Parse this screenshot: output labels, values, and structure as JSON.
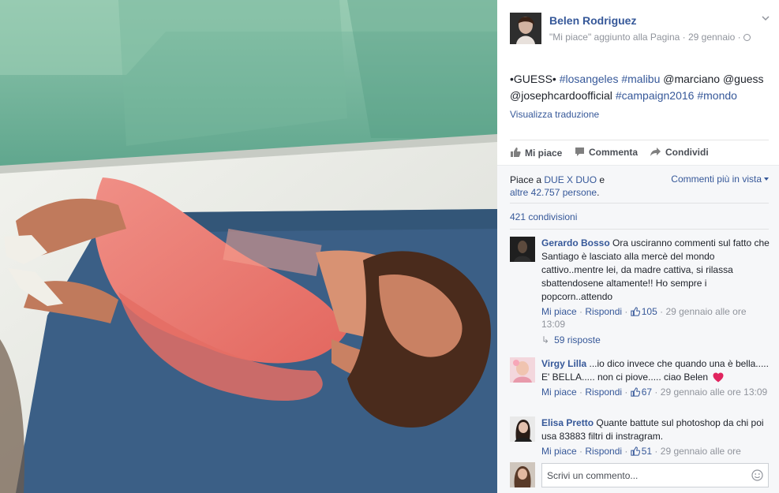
{
  "post": {
    "author": "Belen Rodriguez",
    "meta": "\"Mi piace\" aggiunto alla Pagina · 29 gennaio ·",
    "text_segments": [
      {
        "t": "•GUESS• ",
        "tag": false
      },
      {
        "t": "#losangeles",
        "tag": true
      },
      {
        "t": " ",
        "tag": false
      },
      {
        "t": "#malibu",
        "tag": true
      },
      {
        "t": " @marciano @guess @josephcardoofficial ",
        "tag": false
      },
      {
        "t": "#campaign2016",
        "tag": true
      },
      {
        "t": " ",
        "tag": false
      },
      {
        "t": "#mondo",
        "tag": true
      }
    ],
    "translate": "Visualizza traduzione"
  },
  "actions": {
    "like": "Mi piace",
    "comment": "Commenta",
    "share": "Condividi"
  },
  "social": {
    "likes_prefix": "Piace a ",
    "likes_link1": "DUE X DUO",
    "likes_mid": " e",
    "likes_link2": "altre 42.757 persone",
    "likes_suffix": ".",
    "sort": "Commenti più in vista",
    "shares": "421 condivisioni"
  },
  "comments": [
    {
      "name": "Gerardo Bosso",
      "text": "Ora usciranno commenti sul fatto che Santiago è lasciato alla mercè del mondo cattivo..mentre lei, da madre cattiva, si rilassa sbattendosene altamente!! Ho sempre i popcorn..attendo",
      "like": "Mi piace",
      "reply": "Rispondi",
      "count": "105",
      "time": "29 gennaio alle ore 13:09"
    },
    {
      "name": "Virgy Lilla",
      "text": "...io dico invece che quando una è bella..... E' BELLA..... non ci piove..... ciao Belen",
      "like": "Mi piace",
      "reply": "Rispondi",
      "count": "67",
      "time": "29 gennaio alle ore 13:09"
    },
    {
      "name": "Elisa Pretto",
      "text": "Quante battute sul photoshop da chi poi usa 83883 filtri di instragram.",
      "like": "Mi piace",
      "reply": "Rispondi",
      "count": "51",
      "time": "29 gennaio alle ore"
    }
  ],
  "replies": "59 risposte",
  "composer": {
    "placeholder": "Scrivi un commento..."
  },
  "colors": {
    "link": "#365899",
    "muted": "#90949c",
    "heart": "#e0245e"
  }
}
